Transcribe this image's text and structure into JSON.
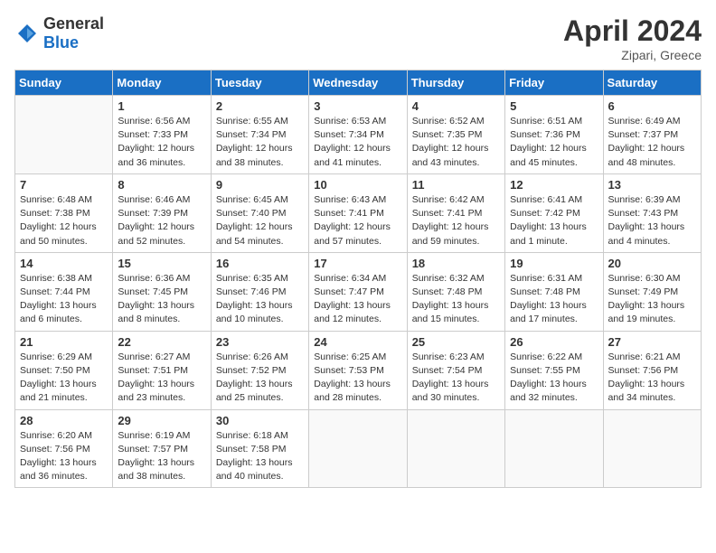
{
  "logo": {
    "general": "General",
    "blue": "Blue"
  },
  "title": "April 2024",
  "location": "Zipari, Greece",
  "days_of_week": [
    "Sunday",
    "Monday",
    "Tuesday",
    "Wednesday",
    "Thursday",
    "Friday",
    "Saturday"
  ],
  "weeks": [
    [
      {
        "day": "",
        "sunrise": "",
        "sunset": "",
        "daylight": ""
      },
      {
        "day": "1",
        "sunrise": "Sunrise: 6:56 AM",
        "sunset": "Sunset: 7:33 PM",
        "daylight": "Daylight: 12 hours and 36 minutes."
      },
      {
        "day": "2",
        "sunrise": "Sunrise: 6:55 AM",
        "sunset": "Sunset: 7:34 PM",
        "daylight": "Daylight: 12 hours and 38 minutes."
      },
      {
        "day": "3",
        "sunrise": "Sunrise: 6:53 AM",
        "sunset": "Sunset: 7:34 PM",
        "daylight": "Daylight: 12 hours and 41 minutes."
      },
      {
        "day": "4",
        "sunrise": "Sunrise: 6:52 AM",
        "sunset": "Sunset: 7:35 PM",
        "daylight": "Daylight: 12 hours and 43 minutes."
      },
      {
        "day": "5",
        "sunrise": "Sunrise: 6:51 AM",
        "sunset": "Sunset: 7:36 PM",
        "daylight": "Daylight: 12 hours and 45 minutes."
      },
      {
        "day": "6",
        "sunrise": "Sunrise: 6:49 AM",
        "sunset": "Sunset: 7:37 PM",
        "daylight": "Daylight: 12 hours and 48 minutes."
      }
    ],
    [
      {
        "day": "7",
        "sunrise": "Sunrise: 6:48 AM",
        "sunset": "Sunset: 7:38 PM",
        "daylight": "Daylight: 12 hours and 50 minutes."
      },
      {
        "day": "8",
        "sunrise": "Sunrise: 6:46 AM",
        "sunset": "Sunset: 7:39 PM",
        "daylight": "Daylight: 12 hours and 52 minutes."
      },
      {
        "day": "9",
        "sunrise": "Sunrise: 6:45 AM",
        "sunset": "Sunset: 7:40 PM",
        "daylight": "Daylight: 12 hours and 54 minutes."
      },
      {
        "day": "10",
        "sunrise": "Sunrise: 6:43 AM",
        "sunset": "Sunset: 7:41 PM",
        "daylight": "Daylight: 12 hours and 57 minutes."
      },
      {
        "day": "11",
        "sunrise": "Sunrise: 6:42 AM",
        "sunset": "Sunset: 7:41 PM",
        "daylight": "Daylight: 12 hours and 59 minutes."
      },
      {
        "day": "12",
        "sunrise": "Sunrise: 6:41 AM",
        "sunset": "Sunset: 7:42 PM",
        "daylight": "Daylight: 13 hours and 1 minute."
      },
      {
        "day": "13",
        "sunrise": "Sunrise: 6:39 AM",
        "sunset": "Sunset: 7:43 PM",
        "daylight": "Daylight: 13 hours and 4 minutes."
      }
    ],
    [
      {
        "day": "14",
        "sunrise": "Sunrise: 6:38 AM",
        "sunset": "Sunset: 7:44 PM",
        "daylight": "Daylight: 13 hours and 6 minutes."
      },
      {
        "day": "15",
        "sunrise": "Sunrise: 6:36 AM",
        "sunset": "Sunset: 7:45 PM",
        "daylight": "Daylight: 13 hours and 8 minutes."
      },
      {
        "day": "16",
        "sunrise": "Sunrise: 6:35 AM",
        "sunset": "Sunset: 7:46 PM",
        "daylight": "Daylight: 13 hours and 10 minutes."
      },
      {
        "day": "17",
        "sunrise": "Sunrise: 6:34 AM",
        "sunset": "Sunset: 7:47 PM",
        "daylight": "Daylight: 13 hours and 12 minutes."
      },
      {
        "day": "18",
        "sunrise": "Sunrise: 6:32 AM",
        "sunset": "Sunset: 7:48 PM",
        "daylight": "Daylight: 13 hours and 15 minutes."
      },
      {
        "day": "19",
        "sunrise": "Sunrise: 6:31 AM",
        "sunset": "Sunset: 7:48 PM",
        "daylight": "Daylight: 13 hours and 17 minutes."
      },
      {
        "day": "20",
        "sunrise": "Sunrise: 6:30 AM",
        "sunset": "Sunset: 7:49 PM",
        "daylight": "Daylight: 13 hours and 19 minutes."
      }
    ],
    [
      {
        "day": "21",
        "sunrise": "Sunrise: 6:29 AM",
        "sunset": "Sunset: 7:50 PM",
        "daylight": "Daylight: 13 hours and 21 minutes."
      },
      {
        "day": "22",
        "sunrise": "Sunrise: 6:27 AM",
        "sunset": "Sunset: 7:51 PM",
        "daylight": "Daylight: 13 hours and 23 minutes."
      },
      {
        "day": "23",
        "sunrise": "Sunrise: 6:26 AM",
        "sunset": "Sunset: 7:52 PM",
        "daylight": "Daylight: 13 hours and 25 minutes."
      },
      {
        "day": "24",
        "sunrise": "Sunrise: 6:25 AM",
        "sunset": "Sunset: 7:53 PM",
        "daylight": "Daylight: 13 hours and 28 minutes."
      },
      {
        "day": "25",
        "sunrise": "Sunrise: 6:23 AM",
        "sunset": "Sunset: 7:54 PM",
        "daylight": "Daylight: 13 hours and 30 minutes."
      },
      {
        "day": "26",
        "sunrise": "Sunrise: 6:22 AM",
        "sunset": "Sunset: 7:55 PM",
        "daylight": "Daylight: 13 hours and 32 minutes."
      },
      {
        "day": "27",
        "sunrise": "Sunrise: 6:21 AM",
        "sunset": "Sunset: 7:56 PM",
        "daylight": "Daylight: 13 hours and 34 minutes."
      }
    ],
    [
      {
        "day": "28",
        "sunrise": "Sunrise: 6:20 AM",
        "sunset": "Sunset: 7:56 PM",
        "daylight": "Daylight: 13 hours and 36 minutes."
      },
      {
        "day": "29",
        "sunrise": "Sunrise: 6:19 AM",
        "sunset": "Sunset: 7:57 PM",
        "daylight": "Daylight: 13 hours and 38 minutes."
      },
      {
        "day": "30",
        "sunrise": "Sunrise: 6:18 AM",
        "sunset": "Sunset: 7:58 PM",
        "daylight": "Daylight: 13 hours and 40 minutes."
      },
      {
        "day": "",
        "sunrise": "",
        "sunset": "",
        "daylight": ""
      },
      {
        "day": "",
        "sunrise": "",
        "sunset": "",
        "daylight": ""
      },
      {
        "day": "",
        "sunrise": "",
        "sunset": "",
        "daylight": ""
      },
      {
        "day": "",
        "sunrise": "",
        "sunset": "",
        "daylight": ""
      }
    ]
  ]
}
